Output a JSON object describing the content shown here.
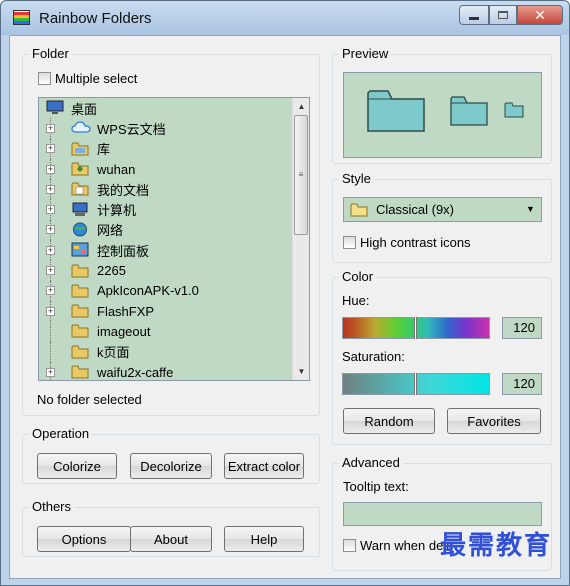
{
  "window": {
    "title": "Rainbow Folders"
  },
  "folder": {
    "group_title": "Folder",
    "multiple_select_label": "Multiple select",
    "tree": [
      {
        "label": "桌面",
        "icon": "desktop-icon",
        "level": 0
      },
      {
        "label": "WPS云文档",
        "icon": "cloud-icon",
        "level": 1,
        "expandable": true
      },
      {
        "label": "库",
        "icon": "library-icon",
        "level": 1,
        "expandable": true
      },
      {
        "label": "wuhan",
        "icon": "user-folder-icon",
        "level": 1,
        "expandable": true
      },
      {
        "label": "我的文档",
        "icon": "documents-icon",
        "level": 1,
        "expandable": true
      },
      {
        "label": "计算机",
        "icon": "computer-icon",
        "level": 1,
        "expandable": true
      },
      {
        "label": "网络",
        "icon": "network-icon",
        "level": 1,
        "expandable": true
      },
      {
        "label": "控制面板",
        "icon": "control-panel-icon",
        "level": 1,
        "expandable": true
      },
      {
        "label": "2265",
        "icon": "folder-icon",
        "level": 1,
        "expandable": true
      },
      {
        "label": "ApkIconAPK-v1.0",
        "icon": "folder-icon",
        "level": 1,
        "expandable": true
      },
      {
        "label": "FlashFXP",
        "icon": "folder-icon",
        "level": 1,
        "expandable": true
      },
      {
        "label": "imageout",
        "icon": "folder-icon",
        "level": 1,
        "expandable": false
      },
      {
        "label": "k页面",
        "icon": "folder-icon",
        "level": 1,
        "expandable": false
      },
      {
        "label": "waifu2x-caffe",
        "icon": "folder-icon",
        "level": 1,
        "expandable": true
      }
    ],
    "status": "No folder selected"
  },
  "operation": {
    "group_title": "Operation",
    "colorize": "Colorize",
    "decolorize": "Decolorize",
    "extract_color": "Extract color"
  },
  "others": {
    "group_title": "Others",
    "options": "Options",
    "about": "About",
    "help": "Help"
  },
  "preview": {
    "group_title": "Preview"
  },
  "style": {
    "group_title": "Style",
    "selected": "Classical (9x)",
    "high_contrast_label": "High contrast icons"
  },
  "color": {
    "group_title": "Color",
    "hue_label": "Hue:",
    "hue_value": "120",
    "saturation_label": "Saturation:",
    "saturation_value": "120",
    "random": "Random",
    "favorites": "Favorites"
  },
  "advanced": {
    "group_title": "Advanced",
    "tooltip_label": "Tooltip text:",
    "warn_label": "Warn when dele"
  },
  "watermark": "最需教育",
  "colors": {
    "field_bg": "#bfd9c4",
    "folder_fill": "#7ec9c9",
    "folder_stroke": "#2d4a4a",
    "window_frame": "#bcd3ea",
    "dialog_bg": "#f0f0f0"
  }
}
